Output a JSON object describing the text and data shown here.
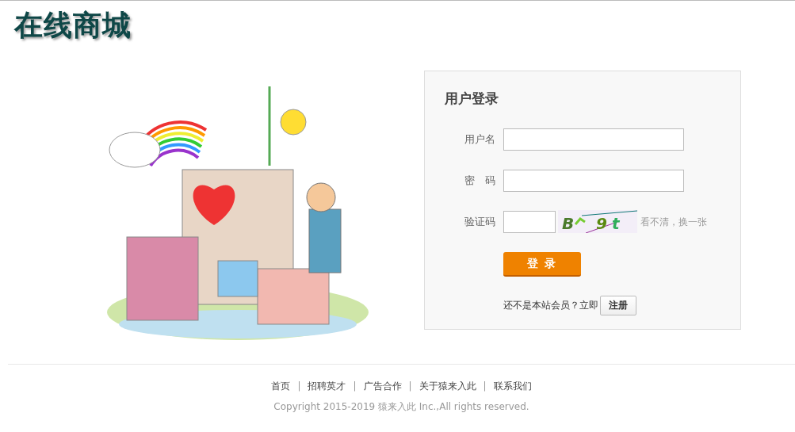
{
  "logo": {
    "text": "在线商城"
  },
  "login": {
    "title": "用户登录",
    "fields": [
      {
        "label": "用户名",
        "kind": "text"
      },
      {
        "label": "密　码",
        "kind": "password"
      },
      {
        "label": "验证码",
        "kind": "captcha",
        "captcha_chars": [
          {
            "char": "B",
            "color": "#4a7a2c"
          },
          {
            "char": "9",
            "color": "#5a8a10"
          },
          {
            "char": "t",
            "color": "#2fae5a"
          }
        ],
        "refresh_link": "看不清，换一张"
      }
    ],
    "submit": "登 录",
    "register_prompt": "还不是本站会员？立即",
    "register_button": "注册"
  },
  "footer": {
    "items": [
      {
        "kind": "link",
        "text": "首页"
      },
      {
        "kind": "separator",
        "text": "|"
      },
      {
        "kind": "link",
        "text": "招聘英才"
      },
      {
        "kind": "separator",
        "text": "|"
      },
      {
        "kind": "link",
        "text": "广告合作"
      },
      {
        "kind": "separator",
        "text": "|"
      },
      {
        "kind": "link",
        "text": "关于猿来入此"
      },
      {
        "kind": "separator",
        "text": "|"
      },
      {
        "kind": "link",
        "text": "联系我们"
      }
    ],
    "copyright": "Copyright 2015-2019 猿来入此 Inc.,All rights reserved."
  }
}
